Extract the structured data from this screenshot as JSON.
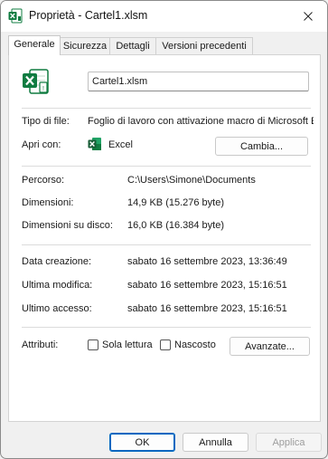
{
  "window": {
    "title": "Proprietà - Cartel1.xlsm"
  },
  "tabs": [
    {
      "label": "Generale"
    },
    {
      "label": "Sicurezza"
    },
    {
      "label": "Dettagli"
    },
    {
      "label": "Versioni precedenti"
    }
  ],
  "general": {
    "file_name": "Cartel1.xlsm",
    "type_label": "Tipo di file:",
    "type_value": "Foglio di lavoro con attivazione macro di Microsoft Ex",
    "open_with_label": "Apri con:",
    "open_with_app": "Excel",
    "change_button": "Cambia...",
    "location_label": "Percorso:",
    "location_value": "C:\\Users\\Simone\\Documents",
    "size_label": "Dimensioni:",
    "size_value": "14,9 KB (15.276 byte)",
    "size_on_disk_label": "Dimensioni su disco:",
    "size_on_disk_value": "16,0 KB (16.384 byte)",
    "created_label": "Data creazione:",
    "created_value": "sabato 16 settembre 2023, 13:36:49",
    "modified_label": "Ultima modifica:",
    "modified_value": "sabato 16 settembre 2023, 15:16:51",
    "accessed_label": "Ultimo accesso:",
    "accessed_value": "sabato 16 settembre 2023, 15:16:51",
    "attributes_label": "Attributi:",
    "readonly_label": "Sola lettura",
    "readonly_checked": false,
    "hidden_label": "Nascosto",
    "hidden_checked": false,
    "advanced_button": "Avanzate..."
  },
  "footer": {
    "ok_label": "OK",
    "cancel_label": "Annulla",
    "apply_label": "Applica"
  },
  "colors": {
    "excel_green": "#107c41",
    "accent": "#0067c0"
  },
  "icons": {
    "title": "excel-file-icon",
    "file": "excel-macro-file-icon",
    "app": "excel-app-icon",
    "close": "close-icon"
  }
}
